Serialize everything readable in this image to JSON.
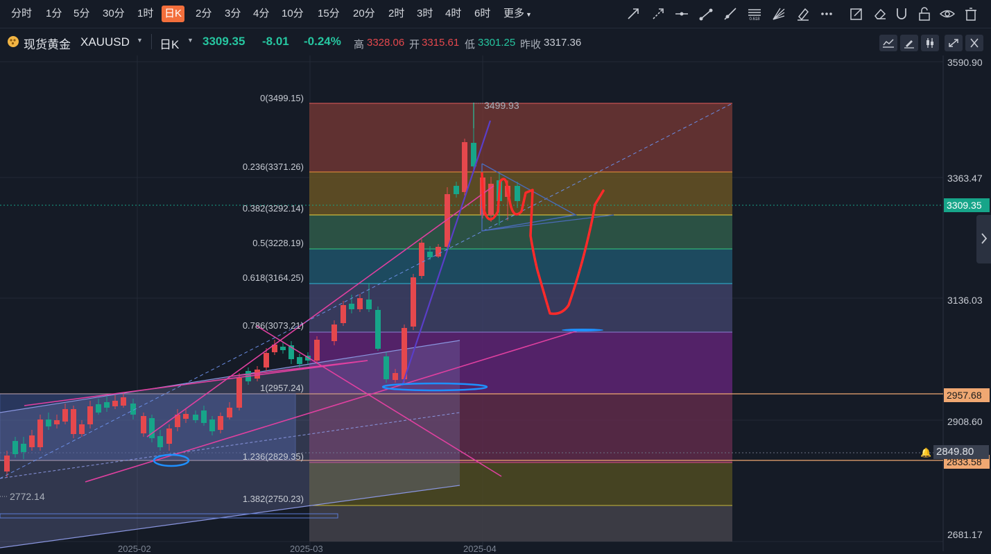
{
  "toolbar": {
    "timeframes": [
      "分时",
      "1分",
      "5分",
      "30分",
      "1时",
      "日K",
      "2分",
      "3分",
      "4分",
      "10分",
      "15分",
      "20分",
      "2时",
      "3时",
      "4时",
      "6时",
      "更多"
    ],
    "active_timeframe": "日K",
    "tools": [
      "arrow-line-icon",
      "dashed-arrow-icon",
      "horizontal-line-icon",
      "trend-line-icon",
      "ray-icon",
      "fibonacci-icon",
      "fan-icon",
      "highlighter-icon",
      "more-tools-icon",
      "edit-icon",
      "eraser-icon",
      "magnet-icon",
      "unlock-icon",
      "eye-icon",
      "trash-icon"
    ]
  },
  "header": {
    "symbol_name": "现货黄金",
    "symbol_code": "XAUUSD",
    "period": "日K",
    "price": "3309.35",
    "change": "-8.01",
    "change_pct": "-0.24%",
    "high_label": "高",
    "high": "3328.06",
    "open_label": "开",
    "open": "3315.61",
    "low_label": "低",
    "low": "3301.25",
    "prev_close_label": "昨收",
    "prev_close": "3317.36",
    "right_buttons": [
      "chart-style-icon",
      "draw-tool-icon",
      "indicator-icon",
      "fullscreen-icon",
      "close-icon"
    ]
  },
  "price_axis": {
    "labels": [
      {
        "text": "3590.90",
        "color": "#e5484d"
      },
      {
        "text": "3363.47",
        "color": "#e5484d"
      },
      {
        "text": "3136.03",
        "color": "#26b8a0"
      },
      {
        "text": "2908.60",
        "color": "#26b8a0"
      },
      {
        "text": "2681.17",
        "color": "#26b8a0"
      }
    ],
    "tags": [
      {
        "text": "3309.35",
        "bg": "#17a589",
        "color": "#ffffff"
      },
      {
        "text": "2957.68",
        "bg": "#f0a872",
        "color": "#1b1b1b"
      },
      {
        "text": "2849.80",
        "bg": "#3a4150",
        "color": "#c8ccd4"
      },
      {
        "text": "2833.58",
        "bg": "#f0a872",
        "color": "#1b1b1b"
      }
    ]
  },
  "date_axis": [
    "2025-02",
    "2025-03",
    "2025-04"
  ],
  "fibonacci": [
    {
      "label": "0(3499.15)",
      "color": "#e65c5c"
    },
    {
      "label": "0.236(3371.26)",
      "color": "#f0913c"
    },
    {
      "label": "0.382(3292.14)",
      "color": "#f0d23c"
    },
    {
      "label": "0.5(3228.19)",
      "color": "#33cc80"
    },
    {
      "label": "0.618(3164.25)",
      "color": "#2eb8d9"
    },
    {
      "label": "0.786(3073.21)",
      "color": "#8c7fd6"
    },
    {
      "label": "1(2957.24)",
      "color": "#b040c0"
    },
    {
      "label": "1.236(2829.35)",
      "color": "#e0508a"
    },
    {
      "label": "1.382(2750.23)",
      "color": "#c8b83c"
    }
  ],
  "annotations": {
    "peak_label": "3499.93",
    "low_label": "2772.14"
  },
  "colors": {
    "up": "#e5484d",
    "down": "#17a589",
    "background": "#151b26"
  }
}
